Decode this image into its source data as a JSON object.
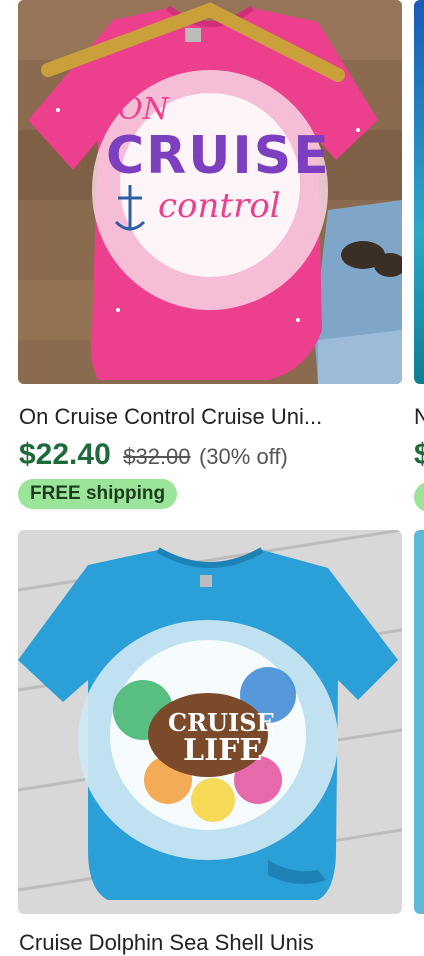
{
  "listings": [
    {
      "title": "On Cruise Control Cruise Uni...",
      "price": "$22.40",
      "original_price": "$32.00",
      "discount": "(30% off)",
      "shipping_badge": "FREE shipping",
      "image": {
        "line1": "ON",
        "line2": "CRUISE",
        "line3": "control"
      }
    },
    {
      "title": "Cruise Dolphin Sea Shell Unis",
      "image": {
        "line1": "CRUISE",
        "line2": "LIFE"
      }
    }
  ],
  "peek": {
    "title_char": "N",
    "price_char": "$"
  },
  "colors": {
    "price": "#1e6b3a",
    "badge": "#9be59a",
    "shirt_pink": "#ec3f8e",
    "shirt_blue": "#2a9fd8"
  }
}
